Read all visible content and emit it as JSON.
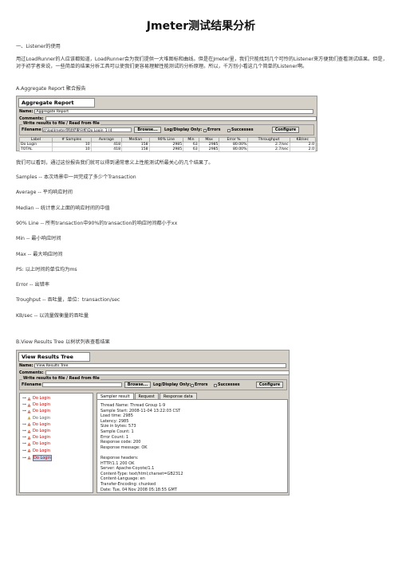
{
  "title": "Jmeter测试结果分析",
  "section1": "一、Listener的使用",
  "intro": "用过LoadRunner的人应该都知道，LoadRunner会为我们提供一大堆图标和曲线。但是在Jmeter里，我们只能找到几个可怜的Listener来方便我们查看测试结果。但是，对于初学者来说，一些简单的结果分析工具可以使我们更容易理解性能测试的分析原理。所以，千万别小看这几个简单的Listener啊。",
  "a_heading": "A.Aggregate Report 聚合报告",
  "agg": {
    "header": "Aggregate Report",
    "name_label": "Name:",
    "name_value": "Aggregate Report",
    "comments_label": "Comments:",
    "group_title": "Write results to file / Read from file",
    "filename_label": "Filename",
    "filename_value": "d:\\log\\Jmeter测试结果分析\\Do Login_1 (4",
    "browse": "Browse...",
    "log_display": "Log/Display Only:",
    "errors": "Errors",
    "successes": "Successes",
    "configure": "Configure",
    "columns": [
      "Label",
      "# Samples",
      "Average",
      "Median",
      "90% Line",
      "Min",
      "Max",
      "Error %",
      "Throughput",
      "KB/sec"
    ],
    "rows": [
      [
        "Do Login",
        "10",
        "418",
        "158",
        "2985",
        "63",
        "2985",
        "80.00%",
        "2.7/sec",
        "2.0"
      ],
      [
        "TOTAL",
        "10",
        "418",
        "158",
        "2985",
        "63",
        "2985",
        "80.00%",
        "2.7/sec",
        "2.0"
      ]
    ]
  },
  "after_agg": "我们可以看到，通过这份报告我们就可以得到通常意义上性能测试所最关心的几个结果了。",
  "defs": [
    "Samples -- 本次场景中一共完成了多少个Transaction",
    "Average -- 平均响应时间",
    "Median -- 统计意义上面的响应时间的中值",
    "90% Line -- 所有transaction中90%的transaction的响应时间都小于xx",
    "Min -- 最小响应时间",
    "Max -- 最大响应时间",
    "PS: 以上时间的单位均为ms",
    "Error -- 出错率",
    "Troughput -- 吞吐量，单位：transaction/sec",
    "KB/sec -- 以流量做衡量的吞吐量"
  ],
  "b_heading": "B.View Results Tree 以树状列表查看结果",
  "tree": {
    "header": "View Results Tree",
    "name_label": "Name:",
    "name_value": "View Results Tree",
    "comments_label": "Comments:",
    "group_title": "Write results to file / Read from file",
    "filename_label": "Filename",
    "browse": "Browse...",
    "log_display": "Log/Display Only:",
    "errors": "Errors",
    "successes": "Successes",
    "configure": "Configure",
    "items": [
      "Do Login",
      "Do Login",
      "Do Login",
      "Do Login",
      "Do Login",
      "Do Login",
      "Do Login",
      "Do Login",
      "Do Login",
      "Do Login"
    ],
    "tabs": [
      "Sampler result",
      "Request",
      "Response data"
    ],
    "detail_lines": [
      "Thread Name: Thread Group 1-9",
      "Sample Start: 2008-11-04 13:22:03 CST",
      "Load time: 2985",
      "Latency: 2985",
      "Size in bytes: 573",
      "Sample Count: 1",
      "Error Count: 1",
      "Response code: 200",
      "Response message: OK",
      "",
      "Response headers:",
      "HTTP/1.1 200 OK",
      "Server: Apache-Coyote/1.1",
      "Content-Type: text/html;charset=GB2312",
      "Content-Language: en",
      "Transfer-Encoding: chunked",
      "Date: Tue, 04 Nov 2008 05:18:55 GMT"
    ]
  }
}
